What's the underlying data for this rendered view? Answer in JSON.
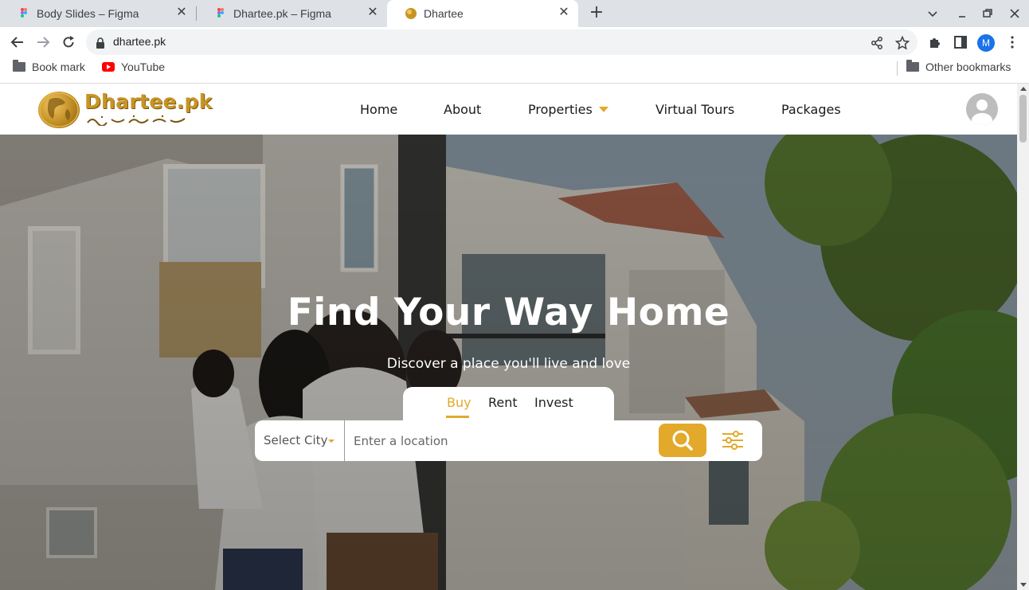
{
  "browser": {
    "tabs": [
      {
        "title": "Body Slides – Figma",
        "favicon": "figma-icon",
        "active": false
      },
      {
        "title": "Dhartee.pk – Figma",
        "favicon": "figma-icon",
        "active": false
      },
      {
        "title": "Dhartee",
        "favicon": "dhartee-logo-icon",
        "active": true
      }
    ],
    "url": "dhartee.pk",
    "profile_initial": "M",
    "bookmarks": [
      {
        "label": "Book mark",
        "icon": "folder-icon"
      },
      {
        "label": "YouTube",
        "icon": "youtube-icon"
      }
    ],
    "other_bookmarks": "Other bookmarks"
  },
  "site": {
    "logo_text": "Dhartee.pk",
    "nav": [
      {
        "label": "Home"
      },
      {
        "label": "About"
      },
      {
        "label": "Properties",
        "has_dropdown": true
      },
      {
        "label": "Virtual Tours"
      },
      {
        "label": "Packages"
      }
    ]
  },
  "hero": {
    "title": "Find Your Way Home",
    "subtitle": "Discover a place you'll live and love",
    "tabs": [
      "Buy",
      "Rent",
      "Invest"
    ],
    "active_tab": "Buy",
    "city_select": "Select City",
    "location_placeholder": "Enter a location"
  },
  "colors": {
    "accent": "#e2a92a",
    "tab_strip": "#dee1e6",
    "omnibox": "#f1f3f4"
  }
}
